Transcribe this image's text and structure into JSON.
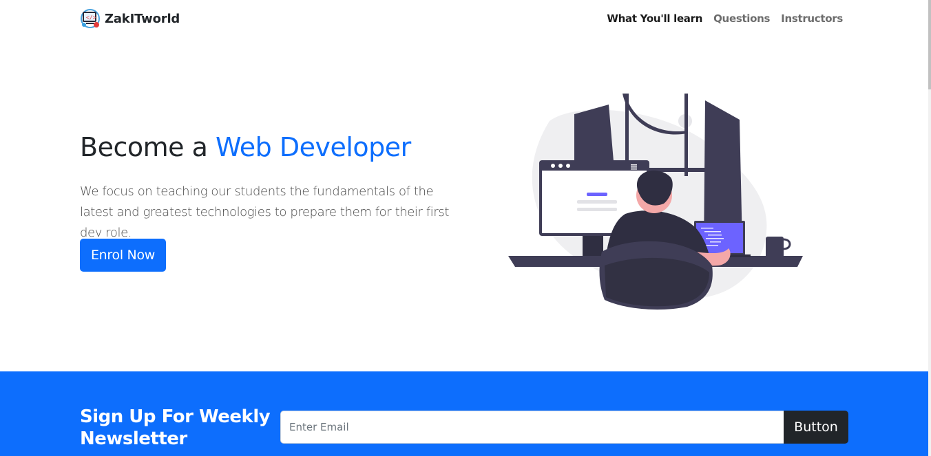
{
  "navbar": {
    "brand": "ZakITworld",
    "brand_icon": "coding-logo-icon",
    "links": [
      {
        "label": "What You'll learn",
        "active": true
      },
      {
        "label": "Questions",
        "active": false
      },
      {
        "label": "Instructors",
        "active": false
      }
    ]
  },
  "hero": {
    "title_plain": "Become a ",
    "title_accent": "Web Developer",
    "lead": "We focus on teaching our students the fundamentals of the latest and greatest technologies to prepare them for their first dev role.",
    "cta_label": "Enrol Now",
    "illustration_icon": "developer-at-desk-illustration"
  },
  "newsletter": {
    "title": "Sign Up For Weekly Newsletter",
    "email_placeholder": "Enter Email",
    "email_value": "",
    "button_label": "Button"
  },
  "colors": {
    "primary": "#0d6efd",
    "dark": "#212529",
    "illustration_dark": "#3f3d56",
    "illustration_accent": "#6c63ff"
  }
}
